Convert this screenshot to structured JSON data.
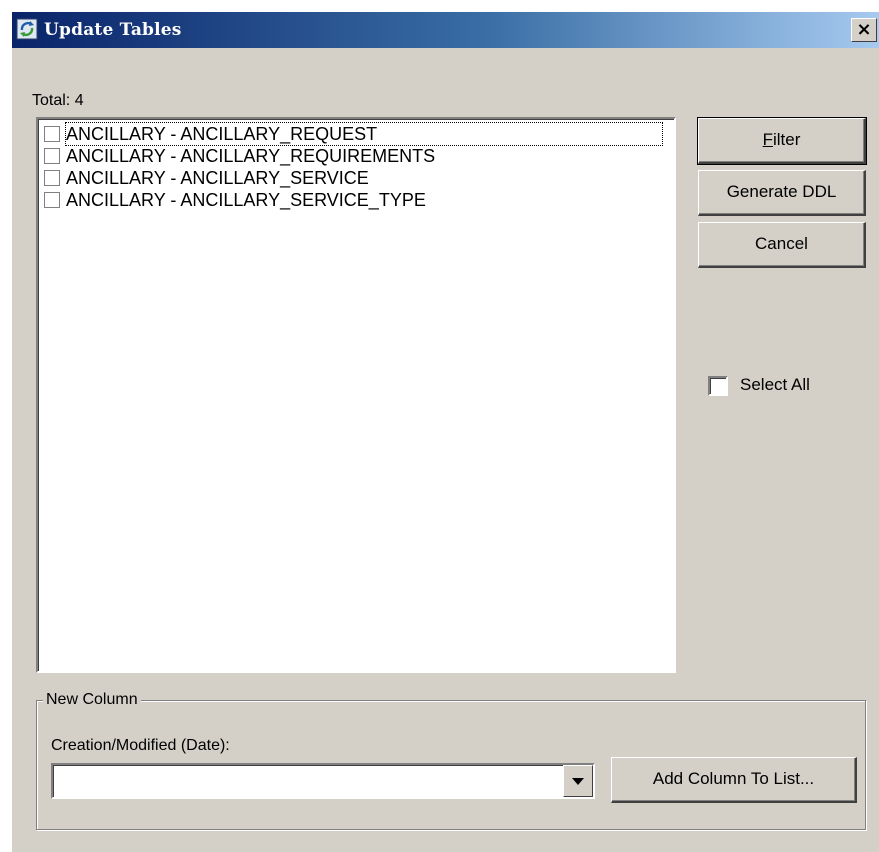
{
  "window": {
    "title": "Update Tables",
    "close_label": "×",
    "titlebar_gradient": [
      "#0a246a",
      "#3a6ea5",
      "#a6caf0"
    ],
    "face_color": "#d4d0c8"
  },
  "list": {
    "total_label": "Total: 4",
    "items": [
      {
        "label": "ANCILLARY - ANCILLARY_REQUEST",
        "checked": false,
        "focused": true
      },
      {
        "label": "ANCILLARY - ANCILLARY_REQUIREMENTS",
        "checked": false,
        "focused": false
      },
      {
        "label": "ANCILLARY - ANCILLARY_SERVICE",
        "checked": false,
        "focused": false
      },
      {
        "label": "ANCILLARY - ANCILLARY_SERVICE_TYPE",
        "checked": false,
        "focused": false
      }
    ]
  },
  "buttons": {
    "filter_prefix": "",
    "filter_accel": "F",
    "filter_rest": "ilter",
    "generate_ddl": "Generate DDL",
    "cancel": "Cancel"
  },
  "select_all": {
    "label": "Select All",
    "checked": false
  },
  "new_column": {
    "group_label": "New Column",
    "field_label": "Creation/Modified (Date):",
    "combo_value": "",
    "add_button": "Add Column To List..."
  },
  "icons": {
    "window_icon": "app-refresh-icon",
    "dropdown_icon": "chevron-down-icon"
  }
}
